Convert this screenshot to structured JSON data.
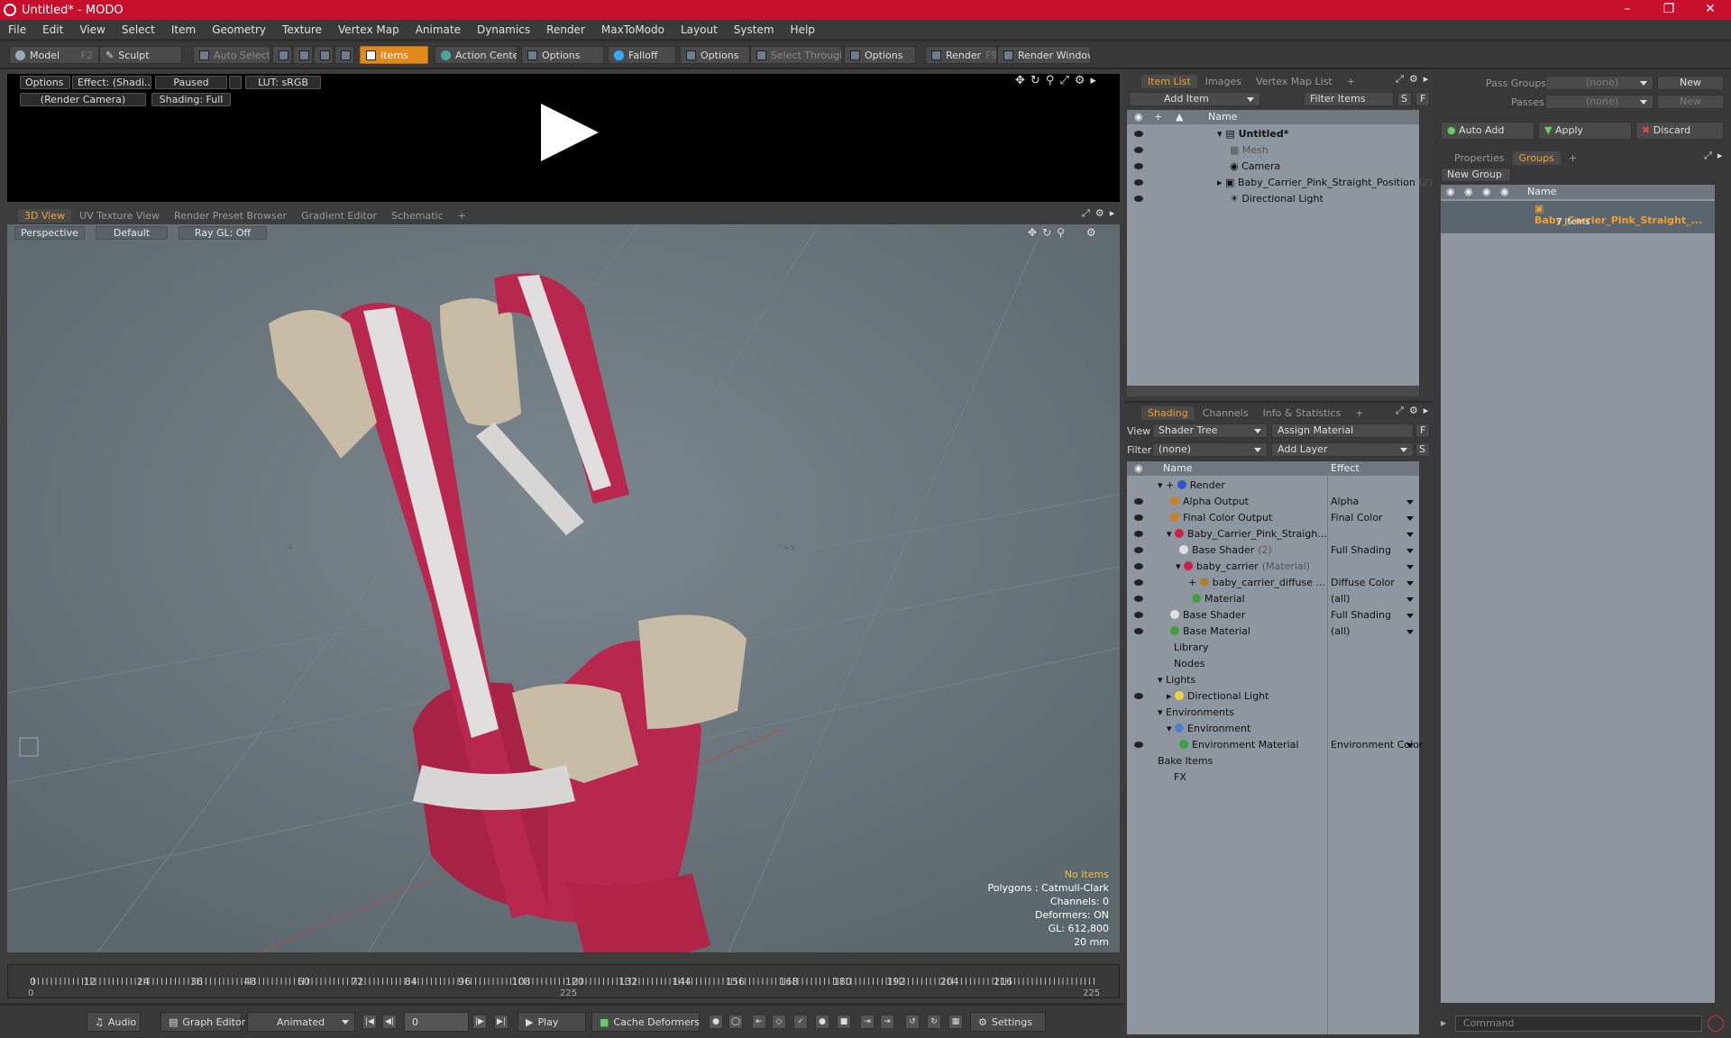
{
  "window": {
    "title": "Untitled* - MODO"
  },
  "menu": [
    "File",
    "Edit",
    "View",
    "Select",
    "Item",
    "Geometry",
    "Texture",
    "Vertex Map",
    "Animate",
    "Dynamics",
    "Render",
    "MaxToModo",
    "Layout",
    "System",
    "Help"
  ],
  "toolbar": {
    "model": "Model",
    "model_key": "F2",
    "sculpt": "Sculpt",
    "auto_select": "Auto Select",
    "items": "Items",
    "action_center": "Action Center",
    "options1": "Options",
    "falloff": "Falloff",
    "options2": "Options",
    "select_through": "Select Through",
    "options3": "Options",
    "render": "Render",
    "render_key": "F9",
    "render_window": "Render Window"
  },
  "preview": {
    "options": "Options",
    "effect": "Effect: (Shadi...",
    "paused": "Paused",
    "lut": "LUT: sRGB",
    "camera": "(Render Camera)",
    "shading": "Shading: Full"
  },
  "viewport_tabs": [
    {
      "label": "3D View",
      "active": true
    },
    {
      "label": "UV Texture View",
      "active": false
    },
    {
      "label": "Render Preset Browser",
      "active": false
    },
    {
      "label": "Gradient Editor",
      "active": false
    },
    {
      "label": "Schematic",
      "active": false
    }
  ],
  "viewport": {
    "perspective": "Perspective",
    "default": "Default",
    "raygl": "Ray GL: Off",
    "stats": {
      "no_items": "No Items",
      "polygons": "Polygons : Catmull-Clark",
      "channels": "Channels: 0",
      "deformers": "Deformers: ON",
      "gl": "GL: 612,800",
      "size": "20 mm"
    }
  },
  "timeline": {
    "ticks": [
      "0",
      "12",
      "24",
      "36",
      "48",
      "60",
      "72",
      "84",
      "96",
      "108",
      "120",
      "132",
      "144",
      "156",
      "168",
      "180",
      "192",
      "204",
      "216"
    ],
    "start": "0",
    "mid": "225",
    "end": "225"
  },
  "bottombar": {
    "audio": "Audio",
    "graph_editor": "Graph Editor",
    "animated": "Animated",
    "frame": "0",
    "play": "Play",
    "cache_deformers": "Cache Deformers",
    "settings": "Settings"
  },
  "item_list": {
    "tabs": [
      {
        "label": "Item List",
        "active": true
      },
      {
        "label": "Images",
        "active": false
      },
      {
        "label": "Vertex Map List",
        "active": false
      }
    ],
    "add_item": "Add Item",
    "filter_items": "Filter Items",
    "col_name": "Name",
    "rows": [
      {
        "name": "Untitled*",
        "indent": 0
      },
      {
        "name": "Mesh",
        "indent": 1
      },
      {
        "name": "Camera",
        "indent": 1
      },
      {
        "name": "Baby_Carrier_Pink_Straight_Position",
        "count": "(2)",
        "indent": 1
      },
      {
        "name": "Directional Light",
        "indent": 1
      }
    ]
  },
  "shading": {
    "tabs": [
      {
        "label": "Shading",
        "active": true
      },
      {
        "label": "Channels",
        "active": false
      },
      {
        "label": "Info & Statistics",
        "active": false
      }
    ],
    "view_label": "View",
    "view_value": "Shader Tree",
    "assign_material": "Assign Material",
    "filter_label": "Filter",
    "filter_value": "(none)",
    "add_layer": "Add Layer",
    "col_name": "Name",
    "col_effect": "Effect",
    "rows": [
      {
        "name": "Render",
        "effect": ""
      },
      {
        "name": "Alpha Output",
        "effect": "Alpha"
      },
      {
        "name": "Final Color Output",
        "effect": "Final Color"
      },
      {
        "name": "Baby_Carrier_Pink_Straigh...",
        "effect": ""
      },
      {
        "name": "Base Shader",
        "suffix": "(2)",
        "effect": "Full Shading"
      },
      {
        "name": "baby_carrier",
        "suffix": "(Material)",
        "effect": ""
      },
      {
        "name": "baby_carrier_diffuse ...",
        "effect": "Diffuse Color"
      },
      {
        "name": "Material",
        "effect": "(all)"
      },
      {
        "name": "Base Shader",
        "effect": "Full Shading"
      },
      {
        "name": "Base Material",
        "effect": "(all)"
      },
      {
        "name": "Library",
        "effect": ""
      },
      {
        "name": "Nodes",
        "effect": ""
      },
      {
        "name": "Lights",
        "effect": ""
      },
      {
        "name": "Directional Light",
        "effect": ""
      },
      {
        "name": "Environments",
        "effect": ""
      },
      {
        "name": "Environment",
        "effect": ""
      },
      {
        "name": "Environment Material",
        "effect": "Environment Color"
      },
      {
        "name": "Bake Items",
        "effect": ""
      },
      {
        "name": "FX",
        "effect": ""
      }
    ]
  },
  "groups": {
    "pass_groups": "Pass Groups",
    "pass_groups_value": "(none)",
    "new1": "New",
    "passes": "Passes",
    "passes_value": "(none)",
    "new2": "New",
    "auto_add": "Auto Add",
    "apply": "Apply",
    "discard": "Discard",
    "tabs": [
      {
        "label": "Properties",
        "active": false
      },
      {
        "label": "Groups",
        "active": true
      }
    ],
    "new_group": "New Group",
    "col_name": "Name",
    "group_name": "Baby_Carrier_Pink_Straight_...",
    "group_count": "7 Items"
  },
  "command": {
    "placeholder": "Command"
  },
  "colors": {
    "title": "#c8102e",
    "accent": "#e08a1e",
    "carrier_pink": "#b8284e",
    "carrier_beige": "#c9bca6"
  }
}
